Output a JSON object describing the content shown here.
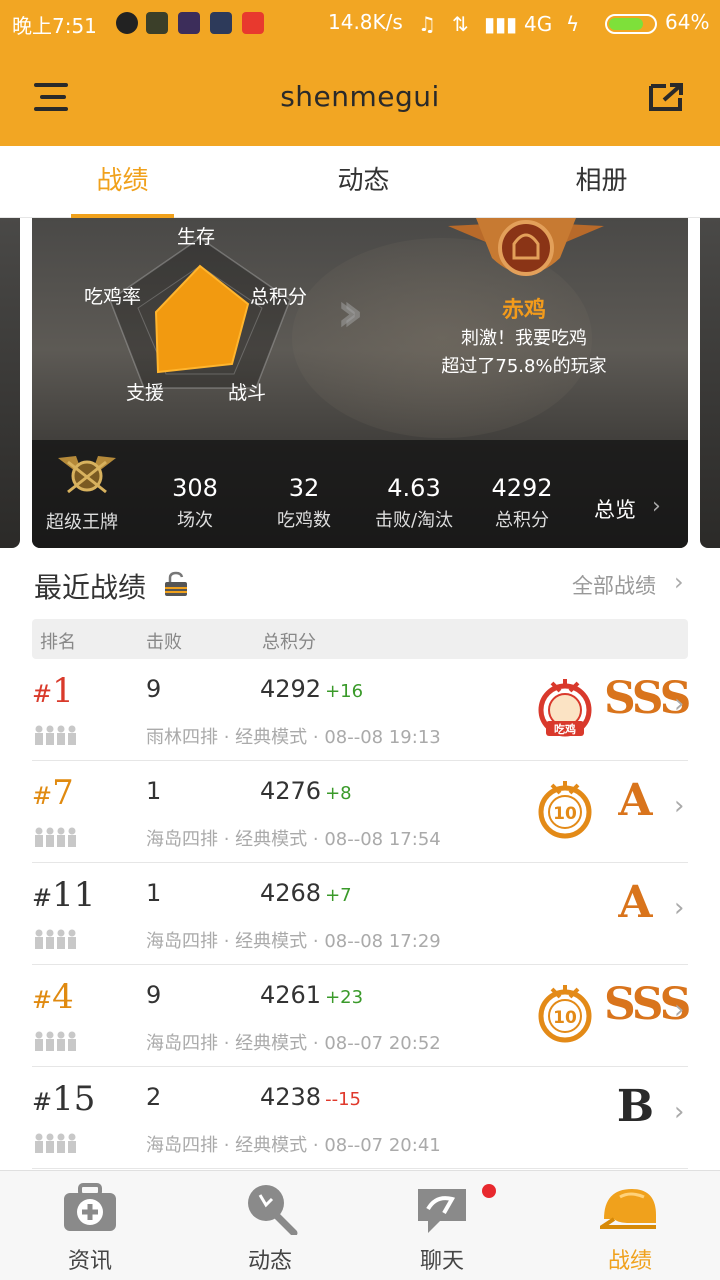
{
  "status_bar": {
    "time": "晚上7:51",
    "speed": "14.8K/s",
    "network": "4G",
    "battery": "64%",
    "battery_level": 0.64
  },
  "header": {
    "title": "shenmegui",
    "bg_color": "#f2a623"
  },
  "tabs": [
    {
      "label": "战绩",
      "active": true
    },
    {
      "label": "动态",
      "active": false
    },
    {
      "label": "相册",
      "active": false
    }
  ],
  "radar": {
    "labels": {
      "top": "生存",
      "right": "总积分",
      "bottom_right": "战斗",
      "bottom_left": "支援",
      "left": "吃鸡率"
    }
  },
  "rank": {
    "name": "赤鸡",
    "line1": "刺激！我要吃鸡",
    "line2": "超过了75.8%的玩家"
  },
  "stats": {
    "tier": "超级王牌",
    "items": [
      {
        "value": "308",
        "label": "场次"
      },
      {
        "value": "32",
        "label": "吃鸡数"
      },
      {
        "value": "4.63",
        "label": "击败/淘汰"
      },
      {
        "value": "4292",
        "label": "总积分"
      }
    ],
    "overview": "总览"
  },
  "recent": {
    "title": "最近战绩",
    "all_link": "全部战绩",
    "headers": {
      "rank": "排名",
      "kills": "击败",
      "score": "总积分"
    },
    "rows": [
      {
        "rank": "1",
        "kills": "9",
        "score": "4292",
        "delta": "+16",
        "mode": "雨林四排 · 经典模式 · 08--08 19:13",
        "medal": "chicken",
        "medal_text": "吃鸡",
        "grade": "SSS"
      },
      {
        "rank": "7",
        "kills": "1",
        "score": "4276",
        "delta": "+8",
        "mode": "海岛四排 · 经典模式 · 08--08 17:54",
        "medal": "top10",
        "medal_text": "10",
        "grade": "A"
      },
      {
        "rank": "11",
        "kills": "1",
        "score": "4268",
        "delta": "+7",
        "mode": "海岛四排 · 经典模式 · 08--08 17:29",
        "medal": "",
        "medal_text": "",
        "grade": "A"
      },
      {
        "rank": "4",
        "kills": "9",
        "score": "4261",
        "delta": "+23",
        "mode": "海岛四排 · 经典模式 · 08--07 20:52",
        "medal": "top10",
        "medal_text": "10",
        "grade": "SSS"
      },
      {
        "rank": "15",
        "kills": "2",
        "score": "4238",
        "delta": "--15",
        "mode": "海岛四排 · 经典模式 · 08--07 20:41",
        "medal": "",
        "medal_text": "",
        "grade": "B"
      }
    ]
  },
  "bottom_nav": [
    {
      "label": "资讯",
      "icon": "medkit-icon",
      "active": false
    },
    {
      "label": "动态",
      "icon": "frying-pan-icon",
      "active": false
    },
    {
      "label": "聊天",
      "icon": "chat-icon",
      "active": false,
      "badge": true
    },
    {
      "label": "战绩",
      "icon": "helmet-icon",
      "active": true
    }
  ],
  "colors": {
    "accent": "#f0a11c",
    "positive": "#3a9a2a",
    "negative": "#e0392c",
    "rank_top": "#d93a2b",
    "rank_mid": "#e08a10"
  }
}
